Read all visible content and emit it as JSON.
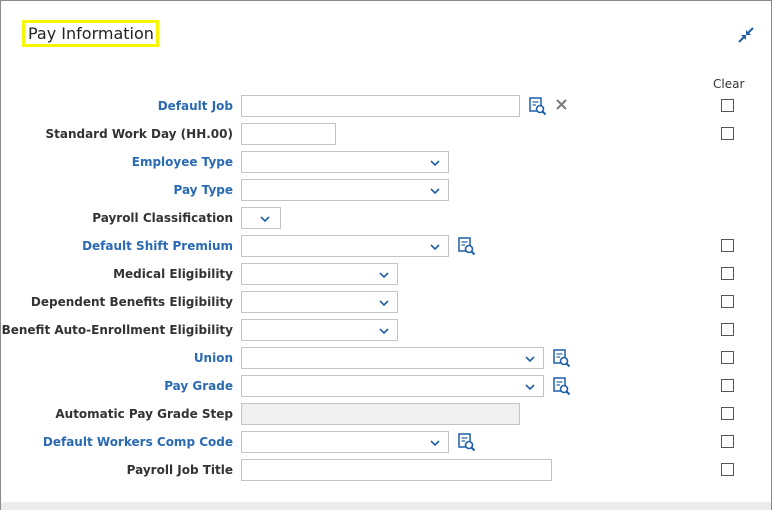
{
  "section": {
    "title": "Pay Information",
    "clear_header": "Clear"
  },
  "fields": [
    {
      "label": "Default Job",
      "link": true,
      "type": "text",
      "value": "",
      "lookup": true,
      "clear_x": true,
      "checkbox": true
    },
    {
      "label": "Standard Work Day (HH.00)",
      "link": false,
      "type": "text",
      "value": "",
      "checkbox": true
    },
    {
      "label": "Employee Type",
      "link": true,
      "type": "select",
      "value": "",
      "checkbox": false
    },
    {
      "label": "Pay Type",
      "link": true,
      "type": "select",
      "value": "",
      "checkbox": false
    },
    {
      "label": "Payroll Classification",
      "link": false,
      "type": "select",
      "value": "",
      "checkbox": false
    },
    {
      "label": "Default Shift Premium",
      "link": true,
      "type": "select",
      "value": "",
      "lookup": true,
      "checkbox": true
    },
    {
      "label": "Medical Eligibility",
      "link": false,
      "type": "select",
      "value": "",
      "checkbox": true
    },
    {
      "label": "Dependent Benefits Eligibility",
      "link": false,
      "type": "select",
      "value": "",
      "checkbox": true
    },
    {
      "label": "Benefit Auto-Enrollment Eligibility",
      "link": false,
      "type": "select",
      "value": "",
      "checkbox": true
    },
    {
      "label": "Union",
      "link": true,
      "type": "select",
      "value": "",
      "lookup": true,
      "checkbox": true
    },
    {
      "label": "Pay Grade",
      "link": true,
      "type": "select",
      "value": "",
      "lookup": true,
      "checkbox": true
    },
    {
      "label": "Automatic Pay Grade Step",
      "link": false,
      "type": "readonly",
      "value": "",
      "checkbox": true
    },
    {
      "label": "Default Workers Comp Code",
      "link": true,
      "type": "select",
      "value": "",
      "lookup": true,
      "checkbox": true
    },
    {
      "label": "Payroll Job Title",
      "link": false,
      "type": "text",
      "value": "",
      "checkbox": true
    }
  ],
  "colors": {
    "link": "#2a6ab3",
    "highlight": "#f7f700",
    "icon": "#1f5fa8"
  },
  "icons": {
    "collapse": "collapse-arrows-icon",
    "lookup": "lookup-search-icon",
    "clear": "close-icon",
    "dropdown": "chevron-down-icon"
  }
}
